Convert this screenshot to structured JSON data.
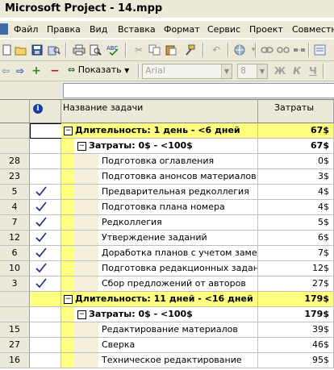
{
  "window": {
    "title": "Microsoft Project - 14.mpp"
  },
  "menu": [
    "Файл",
    "Правка",
    "Вид",
    "Вставка",
    "Формат",
    "Сервис",
    "Проект",
    "Совместная"
  ],
  "toolbar": {
    "show_label": "Показать",
    "font_name": "Arial",
    "font_size": "8",
    "bold": "Ж",
    "italic": "К",
    "underline": "Ч"
  },
  "table": {
    "headers": {
      "indicators": "i",
      "name": "Название задачи",
      "cost": "Затраты"
    },
    "rows": [
      {
        "id": "",
        "check": false,
        "level": 0,
        "name": "Длительность: 1 день - <6 дней",
        "cost": "67$",
        "group": true
      },
      {
        "id": "",
        "check": false,
        "level": 1,
        "name": "Затраты: 0$ - <100$",
        "cost": "67$",
        "group": true
      },
      {
        "id": "28",
        "check": false,
        "level": 2,
        "name": "Подготовка оглавления",
        "cost": "0$",
        "group": false
      },
      {
        "id": "23",
        "check": false,
        "level": 2,
        "name": "Подготовка анонсов материалов ном",
        "cost": "3$",
        "group": false
      },
      {
        "id": "5",
        "check": true,
        "level": 2,
        "name": "Предварительная редколлегия",
        "cost": "4$",
        "group": false
      },
      {
        "id": "4",
        "check": true,
        "level": 2,
        "name": "Подготовка плана номера",
        "cost": "4$",
        "group": false
      },
      {
        "id": "7",
        "check": true,
        "level": 2,
        "name": "Редколлегия",
        "cost": "5$",
        "group": false
      },
      {
        "id": "12",
        "check": true,
        "level": 2,
        "name": "Утверждение заданий",
        "cost": "6$",
        "group": false
      },
      {
        "id": "6",
        "check": true,
        "level": 2,
        "name": "Доработка планов с учетом замечан",
        "cost": "7$",
        "group": false
      },
      {
        "id": "10",
        "check": true,
        "level": 2,
        "name": "Подготовка редакционных заданий",
        "cost": "12$",
        "group": false
      },
      {
        "id": "3",
        "check": true,
        "level": 2,
        "name": "Сбор предложений от авторов",
        "cost": "27$",
        "group": false
      },
      {
        "id": "",
        "check": false,
        "level": 0,
        "name": "Длительность: 11 дней - <16 дней",
        "cost": "179$",
        "group": true
      },
      {
        "id": "",
        "check": false,
        "level": 1,
        "name": "Затраты: 0$ - <100$",
        "cost": "179$",
        "group": true
      },
      {
        "id": "15",
        "check": false,
        "level": 2,
        "name": "Редактирование материалов",
        "cost": "39$",
        "group": false
      },
      {
        "id": "27",
        "check": false,
        "level": 2,
        "name": "Сверка",
        "cost": "46$",
        "group": false
      },
      {
        "id": "16",
        "check": false,
        "level": 2,
        "name": "Техническое редактирование",
        "cost": "95$",
        "group": false
      }
    ]
  }
}
